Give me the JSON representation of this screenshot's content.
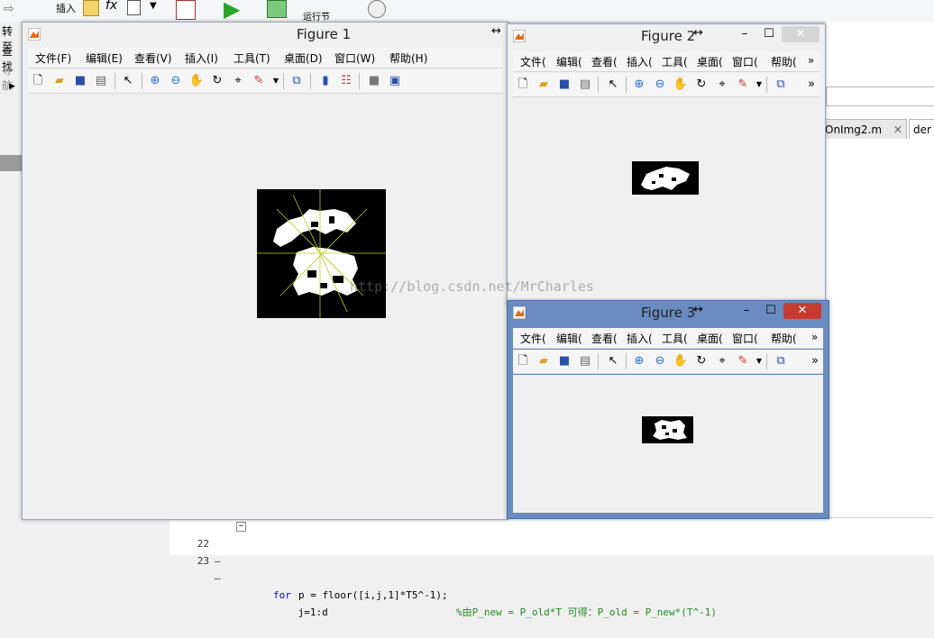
{
  "ide": {
    "toolstrip": {
      "insert_label": "插入",
      "fx_label": "fx",
      "run_section_label": "运行节"
    },
    "left_labels": {
      "goto": "转至",
      "find": "查找",
      "nav": "导航"
    },
    "tabs": [
      {
        "label": "OnImg2.m"
      },
      {
        "label": "der"
      }
    ],
    "code_lines": [
      {
        "num": "22",
        "dash": "–",
        "keyword": "for",
        "code": " j=1:d",
        "comment": ""
      },
      {
        "num": "23",
        "dash": "–",
        "keyword": "",
        "code": "p = floor([i,j,1]*T5^-1);",
        "comment": "%由P_new = P_old*T 可得：P_old = P_new*(T^-1)"
      }
    ]
  },
  "figures": [
    {
      "title": "Figure 1",
      "menus": [
        "文件(F)",
        "编辑(E)",
        "查看(V)",
        "插入(I)",
        "工具(T)",
        "桌面(D)",
        "窗口(W)",
        "帮助(H)"
      ]
    },
    {
      "title": "Figure 2",
      "menus": [
        "文件(",
        "编辑(",
        "查看(",
        "插入(",
        "工具(",
        "桌面(",
        "窗口(",
        "帮助("
      ],
      "overflow": "»"
    },
    {
      "title": "Figure 3",
      "menus": [
        "文件(",
        "编辑(",
        "查看(",
        "插入(",
        "工具(",
        "桌面(",
        "窗口(",
        "帮助("
      ],
      "overflow": "»"
    }
  ],
  "window_buttons": {
    "minimize": "–",
    "maximize": "☐",
    "close": "✕",
    "dock": "↔"
  },
  "watermark": "http://blog.csdn.net/MrCharles",
  "colors": {
    "active_title": "#6a8bc0",
    "close_red": "#c43c30",
    "figure_bg": "#f0f0f0",
    "axes_bg": "#000000",
    "annotation_lines": "#b8d018"
  }
}
